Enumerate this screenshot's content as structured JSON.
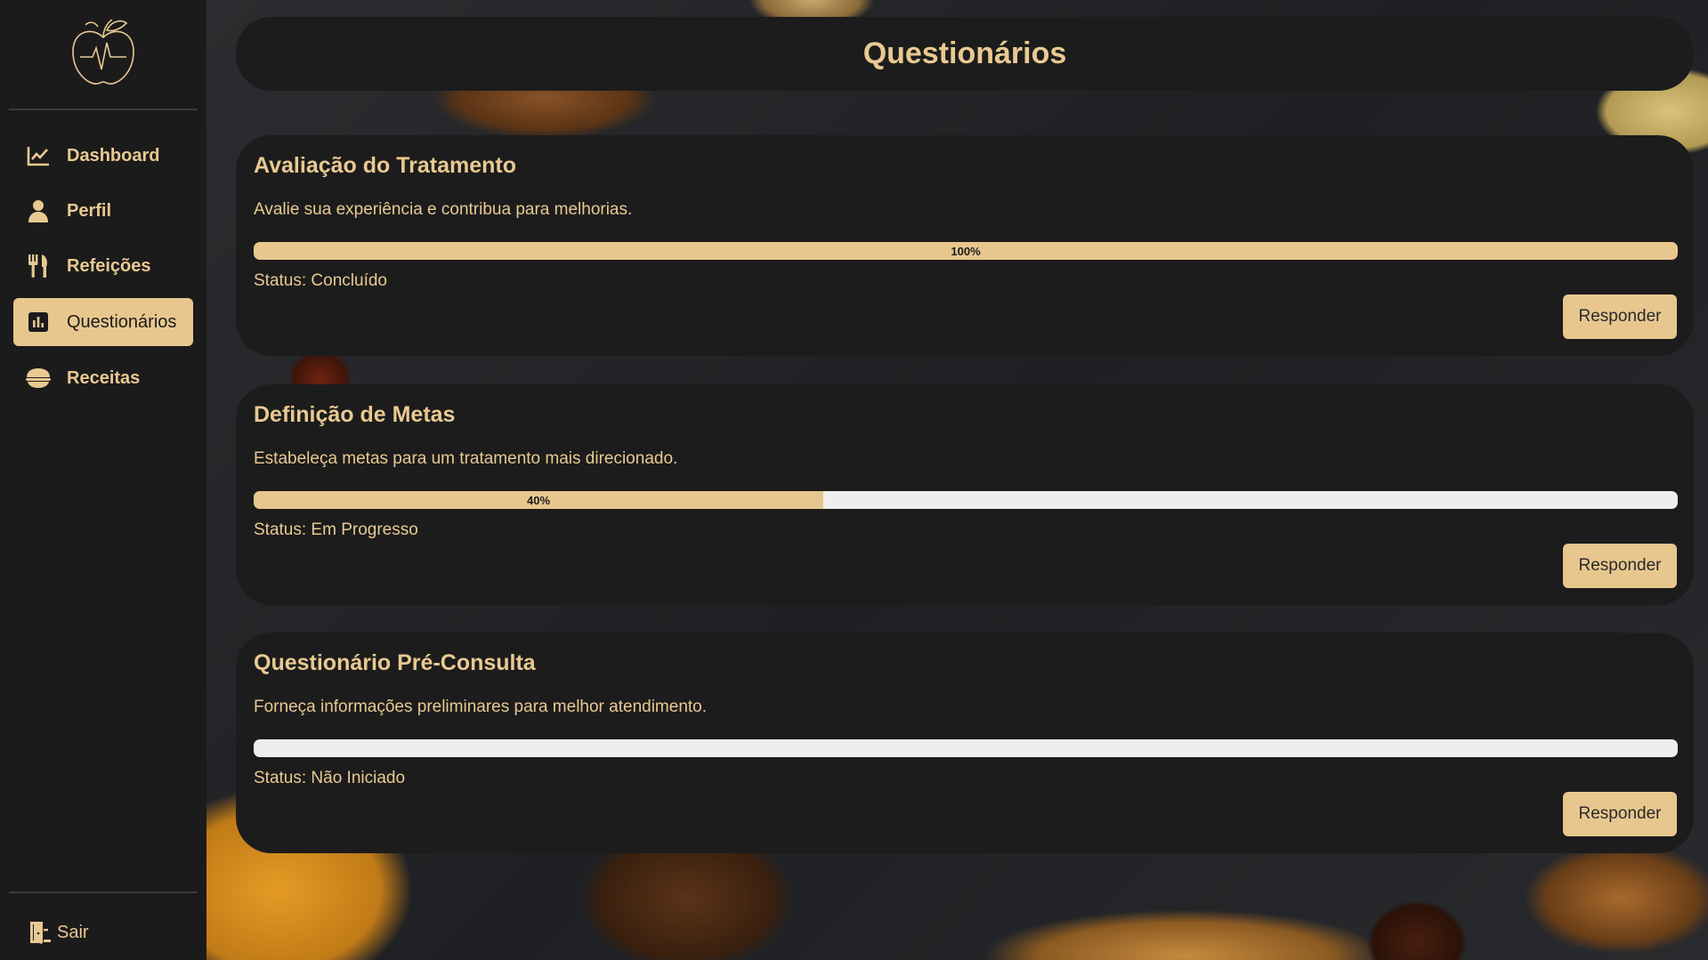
{
  "sidebar": {
    "items": [
      {
        "label": "Dashboard",
        "icon": "chart-line-icon"
      },
      {
        "label": "Perfil",
        "icon": "user-icon"
      },
      {
        "label": "Refeições",
        "icon": "utensils-icon"
      },
      {
        "label": "Questionários",
        "icon": "bar-chart-square-icon"
      },
      {
        "label": "Receitas",
        "icon": "bowl-icon"
      }
    ],
    "active": "Questionários",
    "logout_label": "Sair"
  },
  "header": {
    "title": "Questionários"
  },
  "questionnaires": [
    {
      "title": "Avaliação do Tratamento",
      "description": "Avalie sua experiência e contribua para melhorias.",
      "progress": 100,
      "progress_label": "100%",
      "status": "Status: Concluído",
      "button_label": "Responder"
    },
    {
      "title": "Definição de Metas",
      "description": "Estabeleça metas para um tratamento mais direcionado.",
      "progress": 40,
      "progress_label": "40%",
      "status": "Status: Em Progresso",
      "button_label": "Responder"
    },
    {
      "title": "Questionário Pré-Consulta",
      "description": "Forneça informações preliminares para melhor atendimento.",
      "progress": 0,
      "progress_label": "",
      "status": "Status: Não Iniciado",
      "button_label": "Responder"
    }
  ],
  "colors": {
    "accent": "#e8c78f",
    "panel": "#1c1c1c",
    "progress_track": "#eeeeee"
  }
}
